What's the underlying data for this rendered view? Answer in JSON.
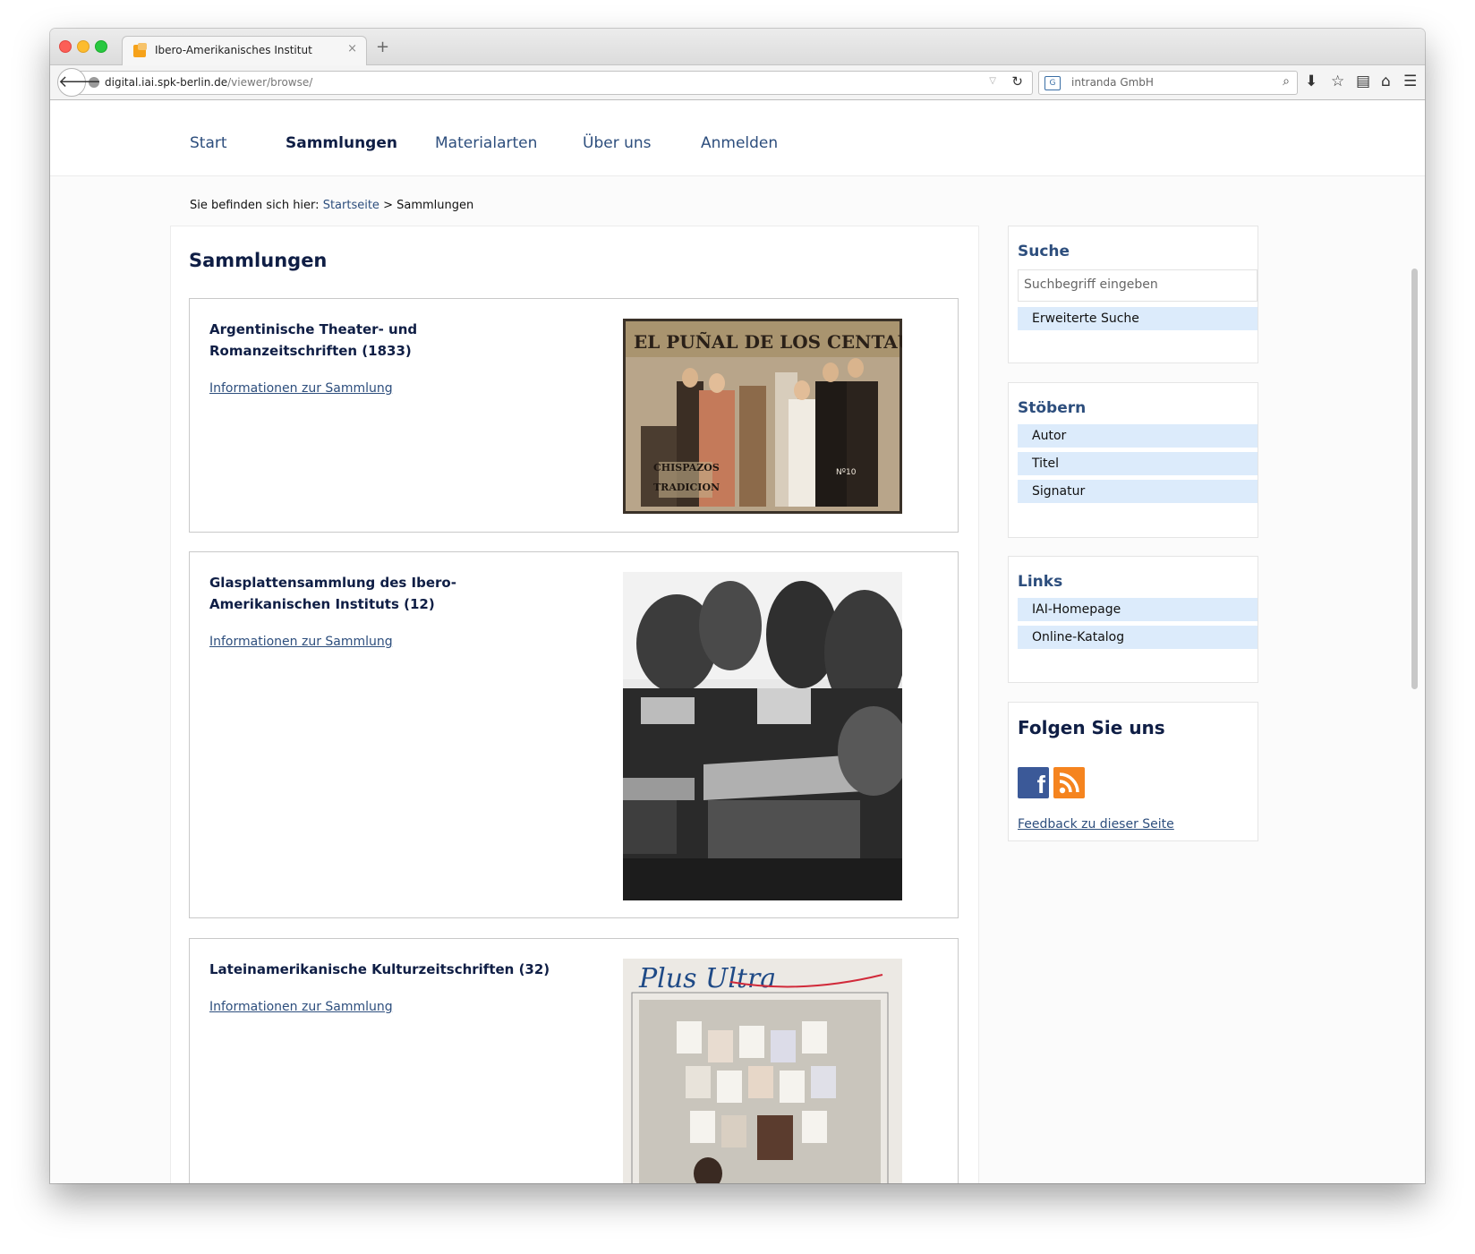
{
  "browser": {
    "tab_title": "Ibero-Amerikanisches Institut",
    "tab_close": "×",
    "new_tab": "+",
    "url_host": "digital.iai.spk-berlin.de",
    "url_path": "/viewer/browse/",
    "search_engine": "intranda GmbH",
    "icons": [
      "back-arrow-icon",
      "globe-icon",
      "reload-icon",
      "search-icon",
      "download-icon",
      "bookmark-star-icon",
      "reading-list-icon",
      "home-icon",
      "menu-icon"
    ]
  },
  "nav": {
    "items": [
      "Start",
      "Sammlungen",
      "Materialarten",
      "Über uns",
      "Anmelden"
    ],
    "active": "Sammlungen"
  },
  "breadcrumb": {
    "prefix": "Sie befinden sich hier:",
    "home": "Startseite",
    "separator": ">",
    "current": "Sammlungen"
  },
  "main": {
    "title": "Sammlungen",
    "collections": [
      {
        "title": "Argentinische Theater- und Romanzeitschriften (1833)",
        "link": "Informationen zur Sammlung",
        "image_text": "EL PUÑAL DE LOS CENTAUROS"
      },
      {
        "title": "Glasplattensammlung des Ibero-Amerikanischen Instituts (12)",
        "link": "Informationen zur Sammlung"
      },
      {
        "title": "Lateinamerikanische Kulturzeitschriften (32)",
        "link": "Informationen zur Sammlung",
        "image_text": "Plus Ultra"
      }
    ]
  },
  "sidebar": {
    "search": {
      "title": "Suche",
      "placeholder": "Suchbegriff eingeben",
      "advanced": "Erweiterte Suche"
    },
    "browse": {
      "title": "Stöbern",
      "items": [
        "Autor",
        "Titel",
        "Signatur"
      ]
    },
    "links": {
      "title": "Links",
      "items": [
        "IAI-Homepage",
        "Online-Katalog"
      ]
    },
    "follow": {
      "title": "Folgen Sie uns",
      "feedback": "Feedback zu dieser Seite",
      "icons": [
        "facebook-icon",
        "rss-icon"
      ]
    }
  },
  "colors": {
    "nav": "#2d4e7d",
    "heading": "#0f1e45",
    "sidebar_item": "#dcebfb",
    "facebook": "#3b5998",
    "rss": "#f5841f"
  }
}
